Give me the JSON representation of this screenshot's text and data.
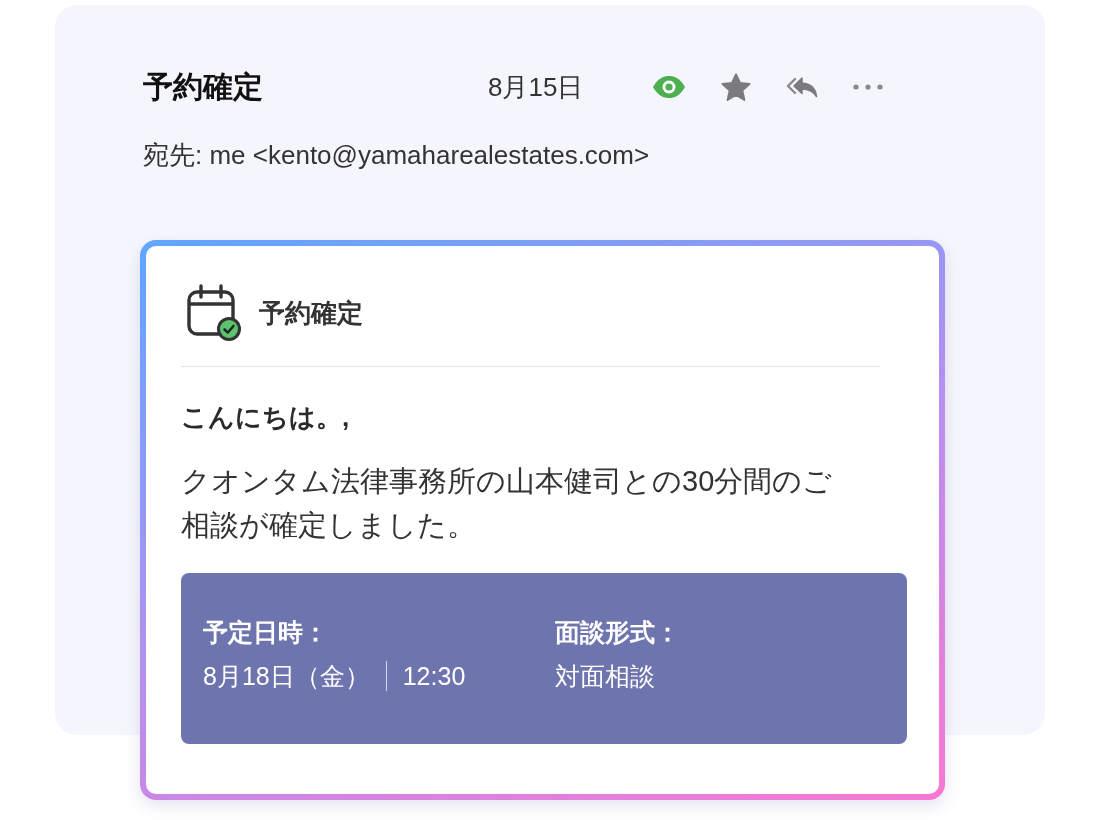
{
  "email": {
    "subject": "予約確定",
    "date": "8月15日",
    "recipient_line": "宛先: me <kento@yamaharealestates.com>"
  },
  "card": {
    "title": "予約確定",
    "greeting": "こんにちは。,",
    "message": "クオンタム法律事務所の山本健司との30分間のご相談が確定しました。",
    "details": [
      {
        "label": "予定日時：",
        "values": [
          "8月18日（金）",
          "12:30"
        ]
      },
      {
        "label": "面談形式：",
        "values": [
          "対面相談"
        ]
      }
    ]
  }
}
